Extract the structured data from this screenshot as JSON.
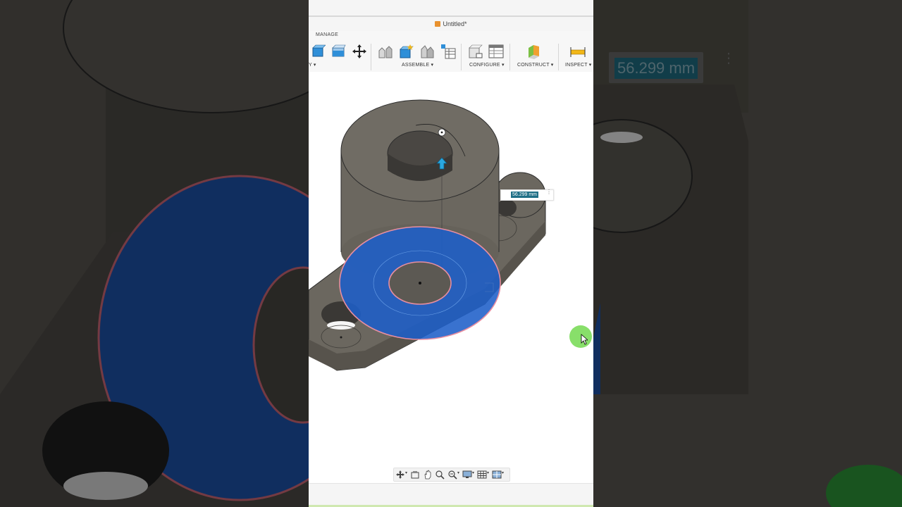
{
  "window": {
    "title": "Untitled*"
  },
  "ribbon": {
    "tab": "MANAGE",
    "groups": [
      {
        "label": "Y",
        "icon": "modify-icon"
      },
      {
        "label": "ASSEMBLE",
        "icon": "joint-icon"
      },
      {
        "label": "CONFIGURE",
        "icon": "configure-icon"
      },
      {
        "label": "CONSTRUCT",
        "icon": "plane-icon"
      },
      {
        "label": "INSPECT",
        "icon": "measure-icon"
      }
    ]
  },
  "viewport": {
    "dimension_value": "56.299 mm",
    "background_dimension_value": "56.299 mm"
  },
  "navbar": {
    "icons": [
      "orbit-icon",
      "look-at-icon",
      "pan-icon",
      "zoom-icon",
      "zoom-window-icon",
      "display-settings-icon",
      "grid-settings-icon",
      "viewports-icon"
    ]
  },
  "colors": {
    "accent": "#1f6f86",
    "selection": "#1e5fc8",
    "body": "#6b675f",
    "cursor": "#7bdc5a"
  }
}
